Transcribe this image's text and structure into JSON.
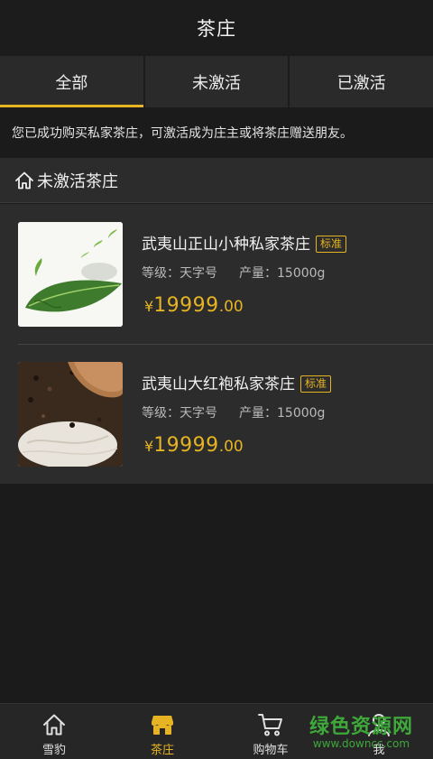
{
  "header": {
    "title": "茶庄"
  },
  "tabs": [
    {
      "label": "全部",
      "active": true
    },
    {
      "label": "未激活",
      "active": false
    },
    {
      "label": "已激活",
      "active": false
    }
  ],
  "notice": "您已成功购买私家茶庄，可激活成为庄主或将茶庄赠送朋友。",
  "section": {
    "icon": "home-icon",
    "title": "未激活茶庄"
  },
  "items": [
    {
      "name": "武夷山正山小种私家茶庄",
      "badge": "标准",
      "grade": "等级：天字号",
      "output": "产量：15000g",
      "price_symbol": "¥",
      "price_int": "19999",
      "price_dec": ".00"
    },
    {
      "name": "武夷山大红袍私家茶庄",
      "badge": "标准",
      "grade": "等级：天字号",
      "output": "产量：15000g",
      "price_symbol": "¥",
      "price_int": "19999",
      "price_dec": ".00"
    }
  ],
  "bottom_nav": [
    {
      "label": "雪豹",
      "icon": "home-icon",
      "active": false
    },
    {
      "label": "茶庄",
      "icon": "shop-icon",
      "active": true
    },
    {
      "label": "购物车",
      "icon": "cart-icon",
      "active": false
    },
    {
      "label": "我",
      "icon": "user-icon",
      "active": false
    }
  ],
  "watermark": {
    "name": "绿色资源网",
    "url": "www.downcc.com"
  },
  "colors": {
    "accent": "#e6b422",
    "background": "#1b1b1b",
    "panel": "#2c2c2c"
  }
}
